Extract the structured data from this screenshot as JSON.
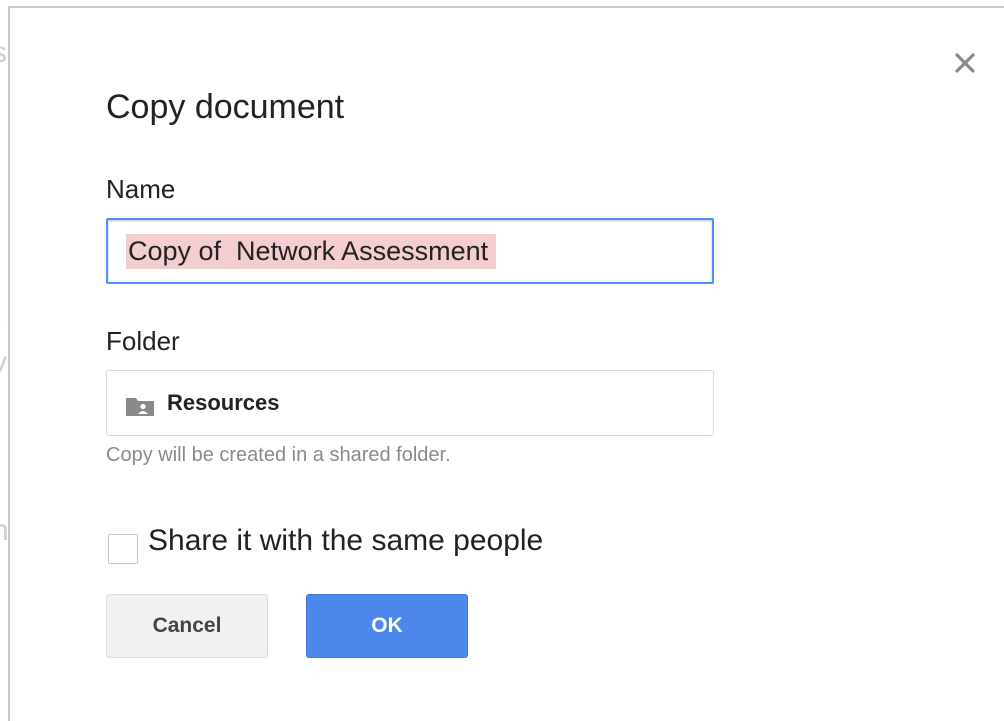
{
  "dialog": {
    "title": "Copy document",
    "close_icon": "close-icon"
  },
  "name_field": {
    "label": "Name",
    "value": "Copy of  Network Assessment"
  },
  "folder_field": {
    "label": "Folder",
    "icon": "shared-folder-icon",
    "value": "Resources",
    "hint": "Copy will be created in a shared folder."
  },
  "share": {
    "label": "Share it with the same people",
    "checked": false
  },
  "buttons": {
    "cancel": "Cancel",
    "ok": "OK"
  },
  "colors": {
    "accent_blue": "#4d87ec",
    "focus_border": "#4d90fe",
    "selection_highlight": "#f3cdd0",
    "hint_text": "#8a8a8a"
  }
}
